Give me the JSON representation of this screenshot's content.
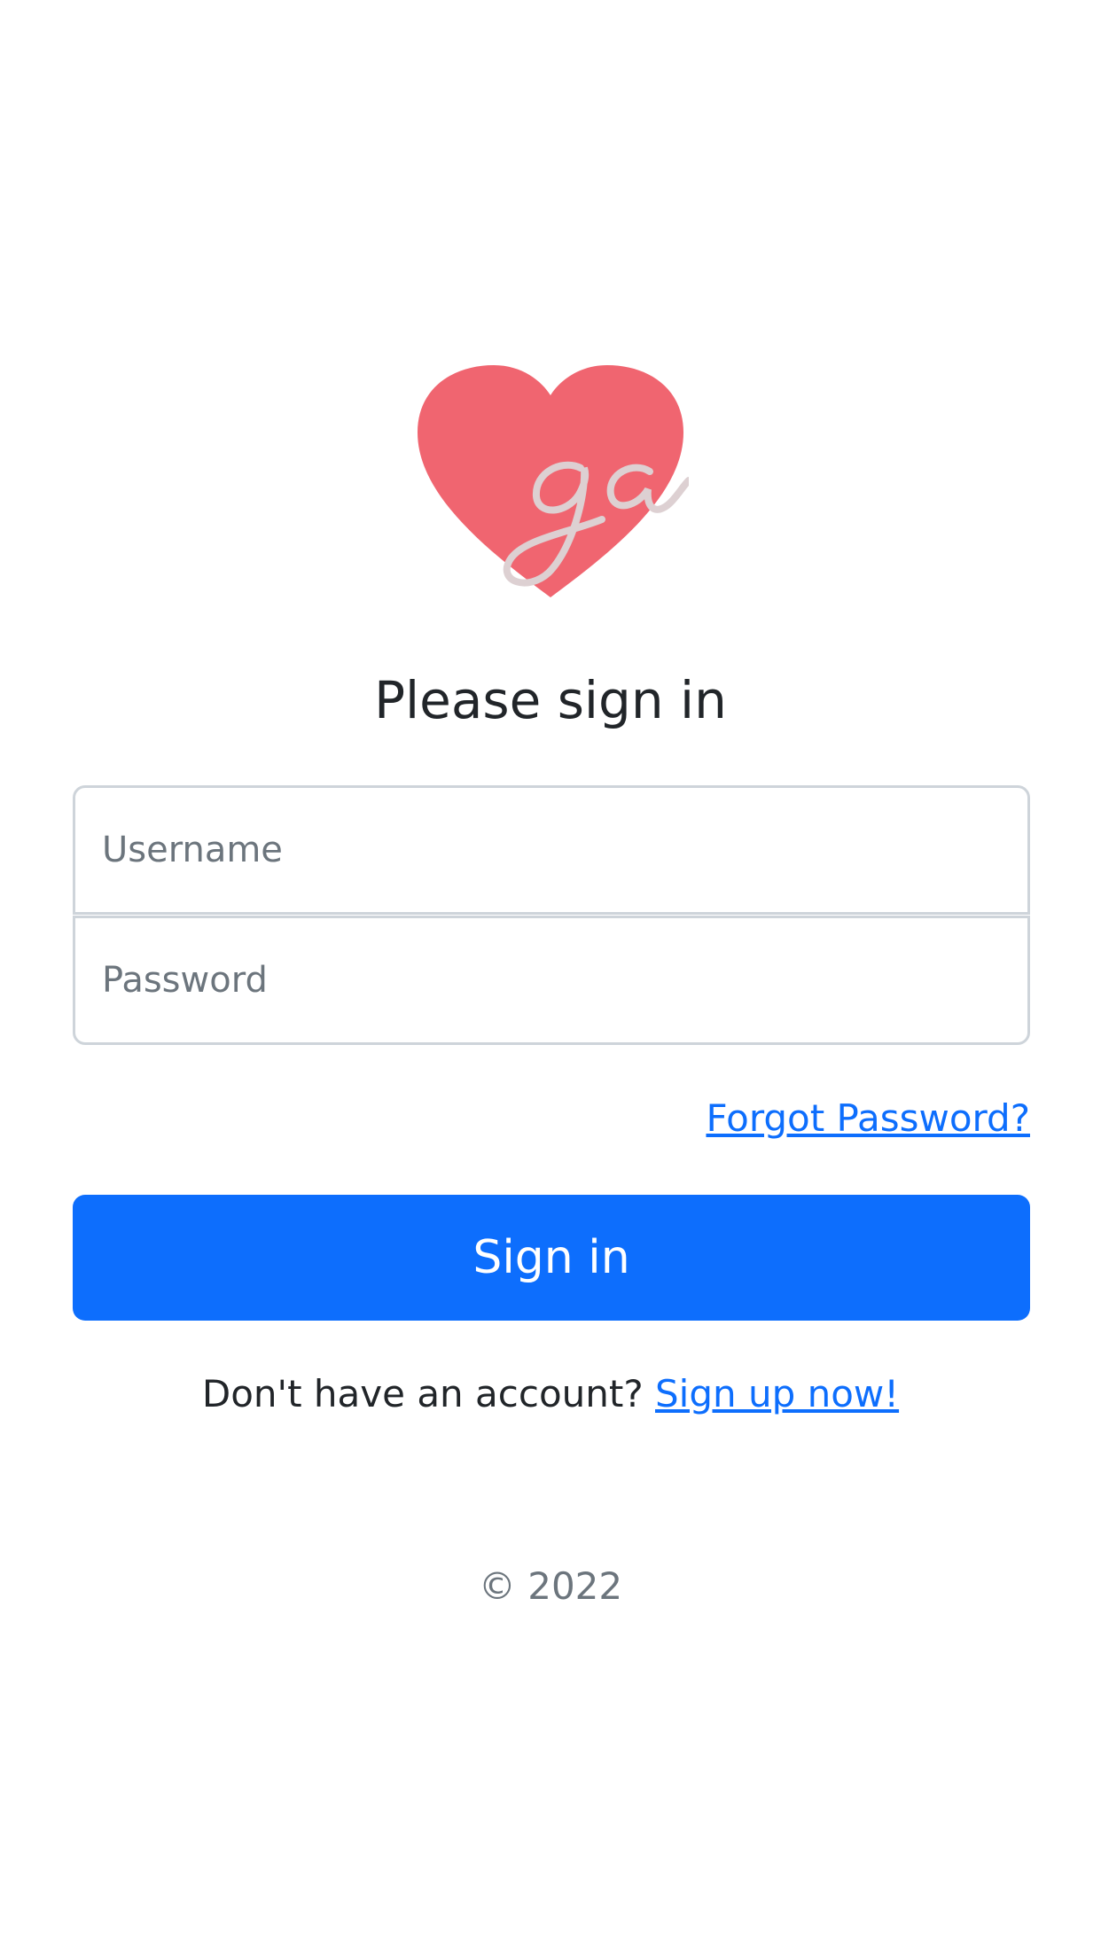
{
  "logo": {
    "icon": "heart-logo",
    "text": "ga",
    "color": "#f06570"
  },
  "title": "Please sign in",
  "form": {
    "username_placeholder": "Username",
    "password_placeholder": "Password",
    "forgot_label": "Forgot Password?",
    "submit_label": "Sign in"
  },
  "signup": {
    "prompt": "Don't have an account?",
    "link_label": "Sign up now!"
  },
  "footer": {
    "copyright": "© 2022"
  },
  "colors": {
    "primary": "#0d6efd",
    "text": "#212529",
    "muted": "#6c757d",
    "border": "#ced4da"
  }
}
